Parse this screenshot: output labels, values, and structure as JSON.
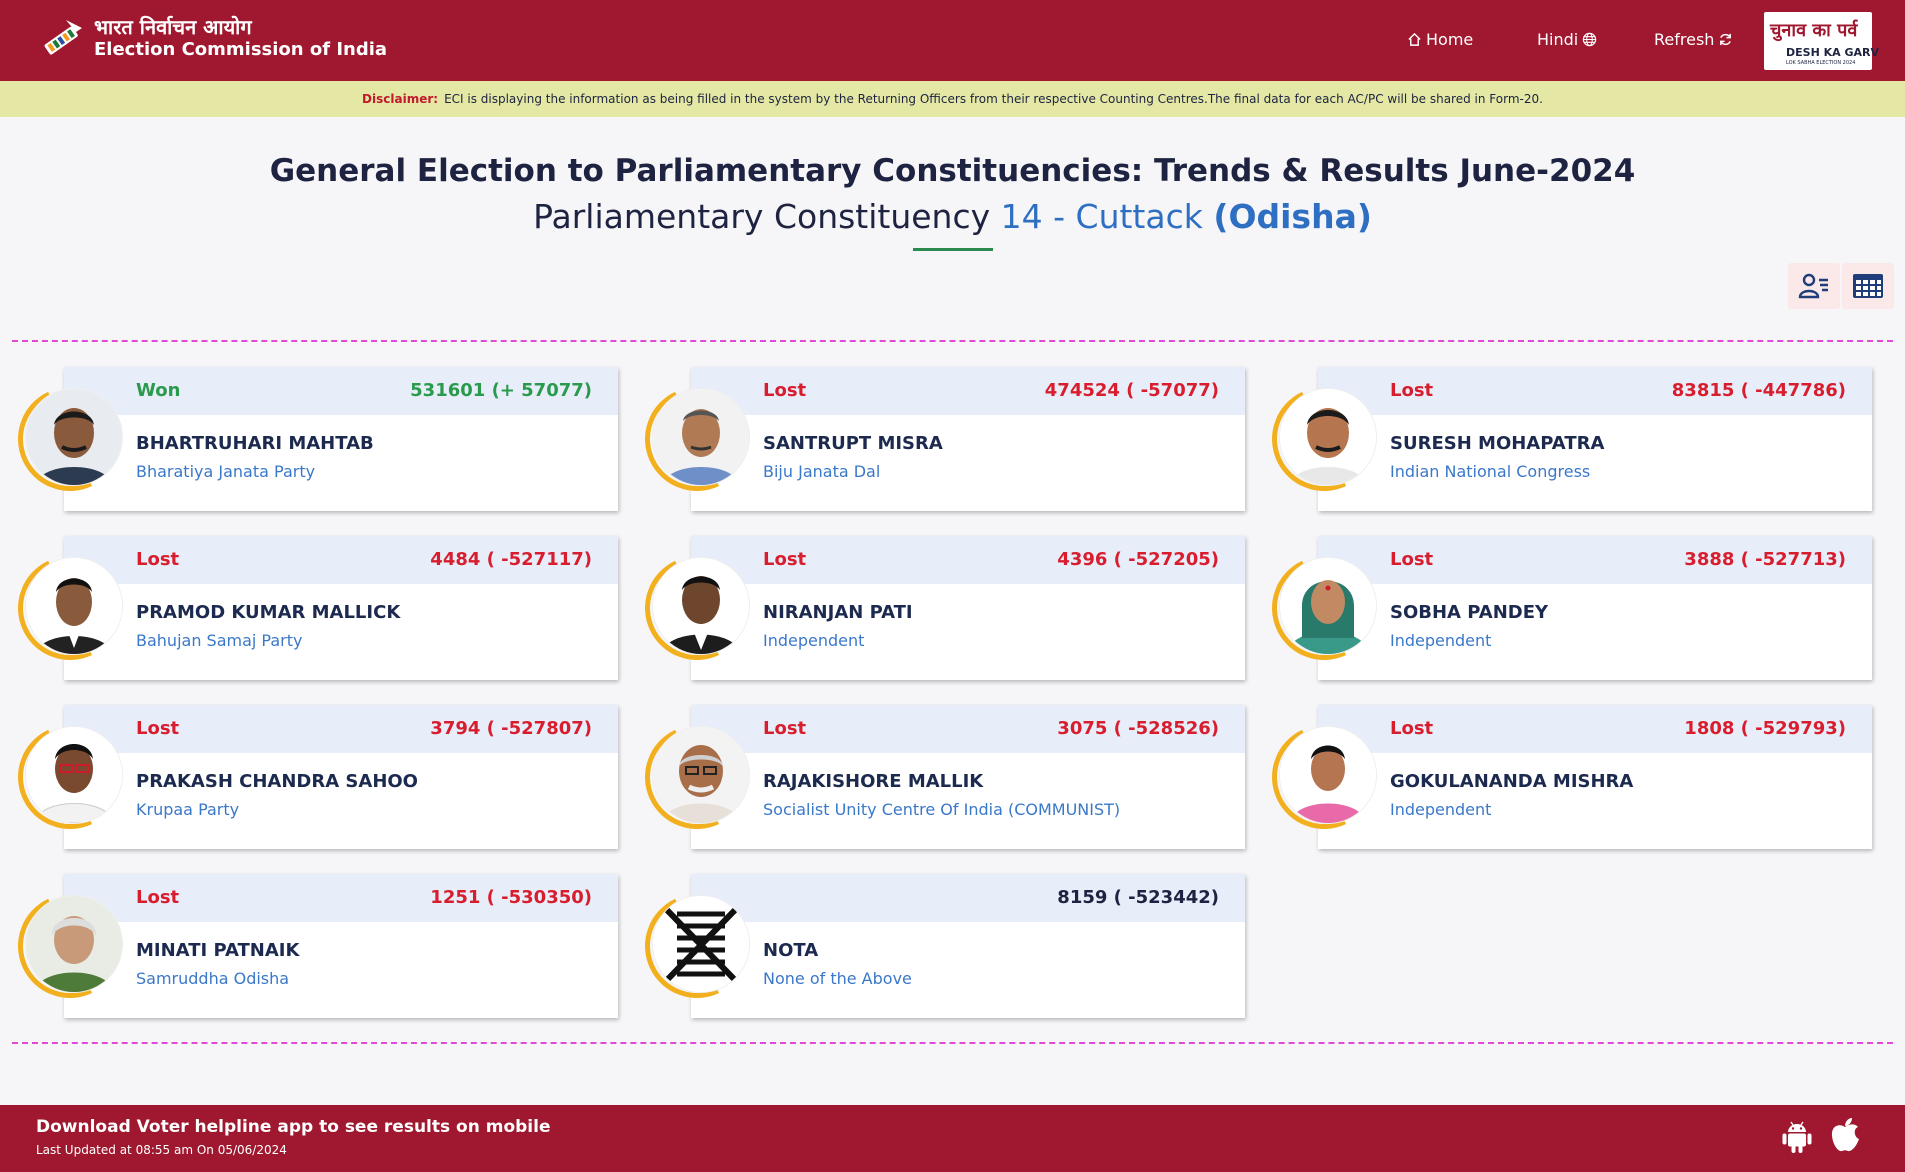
{
  "header": {
    "logo_hindi": "भारत निर्वाचन आयोग",
    "logo_english": "Election Commission of India",
    "nav": {
      "home": "Home",
      "hindi": "Hindi",
      "refresh": "Refresh"
    },
    "badge": {
      "line1": "चुनाव का पर्व",
      "line2": "DESH KA GARV",
      "line3": "LOK SABHA ELECTION 2024"
    }
  },
  "disclaimer": {
    "label": "Disclaimer:",
    "text": "ECI is displaying the information as being filled in the system by the Returning Officers from their respective Counting Centres.The final data for each AC/PC will be shared in Form-20."
  },
  "title": {
    "line1": "General Election to Parliamentary Constituencies: Trends & Results June-2024",
    "prefix": "Parliamentary Constituency",
    "constituency": "14 - Cuttack",
    "state": "(Odisha)"
  },
  "candidates": [
    {
      "status": "Won",
      "votes": "531601 (+ 57077)",
      "name": "BHARTRUHARI MAHTAB",
      "party": "Bharatiya Janata Party"
    },
    {
      "status": "Lost",
      "votes": "474524 ( -57077)",
      "name": "SANTRUPT MISRA",
      "party": "Biju Janata Dal"
    },
    {
      "status": "Lost",
      "votes": "83815 ( -447786)",
      "name": "SURESH MOHAPATRA",
      "party": "Indian National Congress"
    },
    {
      "status": "Lost",
      "votes": "4484 ( -527117)",
      "name": "PRAMOD KUMAR MALLICK",
      "party": "Bahujan Samaj Party"
    },
    {
      "status": "Lost",
      "votes": "4396 ( -527205)",
      "name": "NIRANJAN PATI",
      "party": "Independent"
    },
    {
      "status": "Lost",
      "votes": "3888 ( -527713)",
      "name": "SOBHA PANDEY",
      "party": "Independent"
    },
    {
      "status": "Lost",
      "votes": "3794 ( -527807)",
      "name": "PRAKASH CHANDRA SAHOO",
      "party": "Krupaa Party"
    },
    {
      "status": "Lost",
      "votes": "3075 ( -528526)",
      "name": "RAJAKISHORE MALLIK",
      "party": "Socialist Unity Centre Of India (COMMUNIST)"
    },
    {
      "status": "Lost",
      "votes": "1808 ( -529793)",
      "name": "GOKULANANDA MISHRA",
      "party": "Independent"
    },
    {
      "status": "Lost",
      "votes": "1251 ( -530350)",
      "name": "MINATI PATNAIK",
      "party": "Samruddha Odisha"
    },
    {
      "status": "",
      "votes": "8159 ( -523442)",
      "name": "NOTA",
      "party": "None of the Above"
    }
  ],
  "footer": {
    "line1": "Download Voter helpline app to see results on mobile",
    "line2": "Last Updated at 08:55 am On 05/06/2024"
  },
  "colors": {
    "header_bg": "#a0182f",
    "disclaimer_bg": "#e4e8a4",
    "won": "#2a9a4c",
    "lost": "#d81e2e",
    "party_blue": "#3a78c9",
    "ring_gold": "#f2b01e"
  }
}
